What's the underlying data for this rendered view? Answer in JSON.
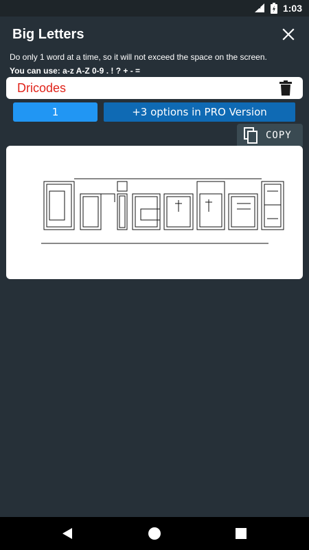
{
  "status": {
    "time": "1:03"
  },
  "app": {
    "title": "Big Letters"
  },
  "hints": {
    "line1": "Do only 1 word at a time, so it will not exceed the space on the screen.",
    "line2": "You can use: a-z A-Z 0-9 . ! ? + - ="
  },
  "input": {
    "value": "Dricodes"
  },
  "options": {
    "selected_label": "1",
    "pro_label": "+3 options in PRO Version"
  },
  "copy": {
    "label": "COPY"
  },
  "output": {
    "word": "Dricodes"
  },
  "colors": {
    "accent": "#2196f3",
    "pro": "#0f6ab4",
    "input_text": "#e0231a",
    "background": "#263038"
  },
  "icons": [
    "close-icon",
    "delete-icon",
    "copy-icon",
    "back-icon",
    "home-icon",
    "recent-icon",
    "wifi-icon",
    "battery-icon"
  ]
}
